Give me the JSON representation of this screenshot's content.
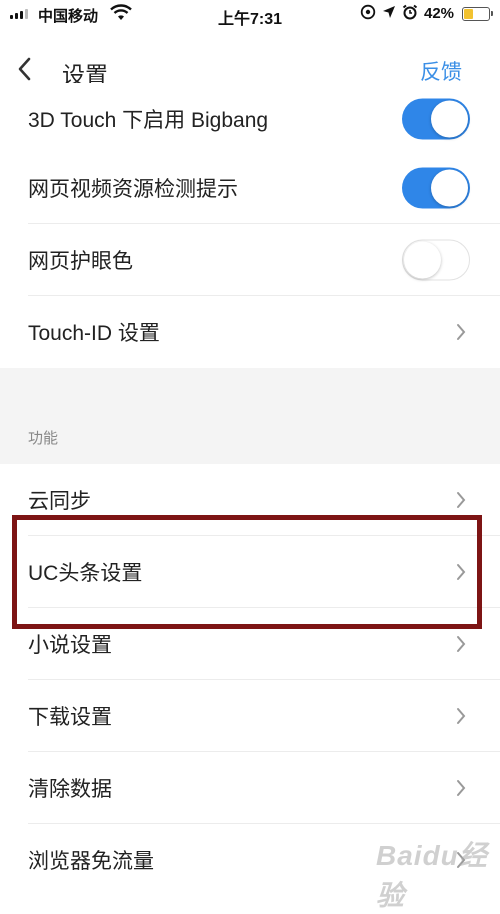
{
  "status_bar": {
    "carrier": "中国移动",
    "time": "上午7:31",
    "battery_percent": "42%",
    "battery_level": 0.42,
    "battery_color": "#f2c230"
  },
  "nav": {
    "title": "设置",
    "feedback_label": "反馈",
    "accent_color": "#3b8fe6"
  },
  "toggle_rows": [
    {
      "label": "3D Touch 下启用 Bigbang",
      "state": "on"
    },
    {
      "label": "网页视频资源检测提示",
      "state": "on"
    },
    {
      "label": "网页护眼色",
      "state": "off"
    }
  ],
  "touch_id_row": {
    "label": "Touch-ID 设置"
  },
  "section": {
    "title": "功能"
  },
  "feature_rows": [
    {
      "label": "云同步"
    },
    {
      "label": "UC头条设置"
    },
    {
      "label": "小说设置"
    },
    {
      "label": "下载设置"
    },
    {
      "label": "清除数据"
    },
    {
      "label": "浏览器免流量"
    }
  ],
  "watermark": "Baidu经验",
  "toggle_on_color": "#2f86e8",
  "highlight_color": "#7d1414"
}
